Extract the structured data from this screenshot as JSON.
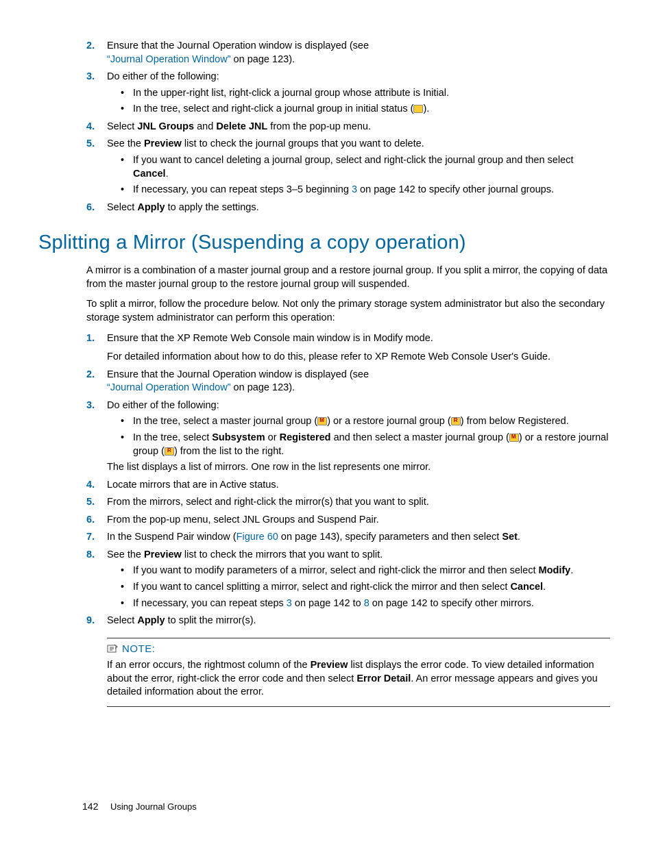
{
  "top_steps": {
    "s2": {
      "line1": "Ensure that the Journal Operation window is displayed (see",
      "link": "“Journal Operation Window”",
      "after_link": " on page 123)."
    },
    "s3": {
      "lead": "Do either of the following:",
      "b1": "In the upper-right list, right-click a journal group whose attribute is Initial.",
      "b2_before": "In the tree, select and right-click a journal group in initial status (",
      "b2_after": ")."
    },
    "s4": {
      "before1": "Select ",
      "bold1": "JNL Groups",
      "mid": " and ",
      "bold2": "Delete JNL",
      "after": " from the pop-up menu."
    },
    "s5": {
      "lead_before": "See the ",
      "lead_bold": "Preview",
      "lead_after": " list to check the journal groups that you want to delete.",
      "b1_before": "If you want to cancel deleting a journal group, select and right-click the journal group and then select ",
      "b1_bold": "Cancel",
      "b1_after": ".",
      "b2_before": "If necessary, you can repeat steps 3–5 beginning ",
      "b2_link": "3",
      "b2_after": " on page 142 to specify other journal groups."
    },
    "s6": {
      "before": "Select ",
      "bold": "Apply",
      "after": " to apply the settings."
    }
  },
  "heading": "Splitting a Mirror (Suspending a copy operation)",
  "para1": "A mirror is a combination of a master journal group and a restore journal group. If you split a mirror, the copying of data from the master journal group to the restore journal group will suspended.",
  "para2": "To split a mirror, follow the procedure below. Not only the primary storage system administrator but also the secondary storage system administrator can perform this operation:",
  "steps": {
    "s1": {
      "line1": "Ensure that the XP Remote Web Console main window is in Modify mode.",
      "line2": "For detailed information about how to do this, please refer to XP Remote Web Console User's Guide."
    },
    "s2": {
      "line1": "Ensure that the Journal Operation window is displayed (see",
      "link": "“Journal Operation Window”",
      "after_link": " on page 123)."
    },
    "s3": {
      "lead": "Do either of the following:",
      "b1_before": "In the tree, select a master journal group (",
      "b1_mid": ") or a restore journal group (",
      "b1_after": ") from below Registered.",
      "b2_before": "In the tree, select ",
      "b2_bold1": "Subsystem",
      "b2_mid1": " or ",
      "b2_bold2": "Registered",
      "b2_mid2": " and then select a master journal group (",
      "b2_mid3": ") or a restore journal group (",
      "b2_after": ") from the list to the right.",
      "tail": "The list displays a list of mirrors. One row in the list represents one mirror."
    },
    "s4": "Locate mirrors that are in Active status.",
    "s5": "From the mirrors, select and right-click the mirror(s) that you want to split.",
    "s6": "From the pop-up menu, select JNL Groups and Suspend Pair.",
    "s7": {
      "before": "In the Suspend Pair window (",
      "link": "Figure 60",
      "mid": " on page 143), specify parameters and then select ",
      "bold": "Set",
      "after": "."
    },
    "s8": {
      "lead_before": "See the ",
      "lead_bold": "Preview",
      "lead_after": " list to check the mirrors that you want to split.",
      "b1_before": "If you want to modify parameters of a mirror, select and right-click the mirror and then select ",
      "b1_bold": "Modify",
      "b1_after": ".",
      "b2_before": "If you want to cancel splitting a mirror, select and right-click the mirror and then select ",
      "b2_bold": "Cancel",
      "b2_after": ".",
      "b3_before": "If necessary, you can repeat steps ",
      "b3_link1": "3",
      "b3_mid1": " on page 142 to ",
      "b3_link2": "8",
      "b3_after": " on page 142 to specify other mirrors."
    },
    "s9": {
      "before": "Select ",
      "bold": "Apply",
      "after": " to split the mirror(s)."
    }
  },
  "note": {
    "label": "NOTE:",
    "body_before": "If an error occurs, the rightmost column of the ",
    "body_bold1": "Preview",
    "body_mid1": " list displays the error code. To view detailed information about the error, right-click the error code and then select ",
    "body_bold2": "Error Detail",
    "body_after": ". An error message appears and gives you detailed information about the error."
  },
  "footer": {
    "page": "142",
    "title": "Using Journal Groups"
  }
}
